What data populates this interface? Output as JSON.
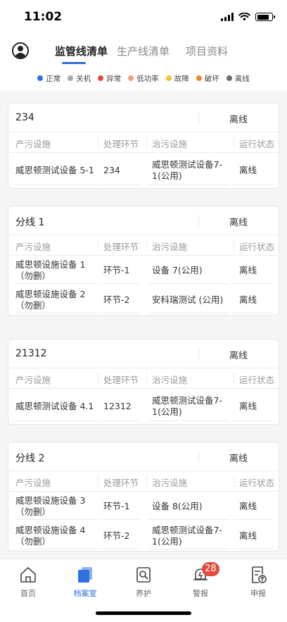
{
  "status_bar": {
    "time": "11:02"
  },
  "header": {
    "tabs": [
      {
        "label": "监管线清单",
        "active": true
      },
      {
        "label": "生产线清单",
        "active": false
      },
      {
        "label": "项目资料",
        "active": false
      }
    ]
  },
  "legend": [
    {
      "label": "正常",
      "color": "#2f6fdf"
    },
    {
      "label": "关机",
      "color": "#a9a9a9"
    },
    {
      "label": "异常",
      "color": "#e0463c"
    },
    {
      "label": "低功率",
      "color": "#f0a07a"
    },
    {
      "label": "故障",
      "color": "#f2c12e"
    },
    {
      "label": "破坏",
      "color": "#e88a2e"
    },
    {
      "label": "离线",
      "color": "#6b6b6b"
    }
  ],
  "columns": {
    "col1": "产污设施",
    "col2": "处理环节",
    "col3": "治污设施",
    "col4": "运行状态"
  },
  "cards": [
    {
      "title": "234",
      "status": "离线",
      "rows": [
        {
          "facility": "威思顿测试设备 5-1",
          "stage": "234",
          "treatment": "威思顿测试设备7-1(公用)",
          "state": "离线"
        }
      ]
    },
    {
      "title": "分线 1",
      "status": "离线",
      "rows": [
        {
          "facility": "威思顿设施设备 1（勿删）",
          "stage": "环节-1",
          "treatment": "设备 7(公用)",
          "state": "离线"
        },
        {
          "facility": "威思顿设施设备 2（勿删）",
          "stage": "环节-2",
          "treatment": "安科瑞测试 (公用)",
          "state": "离线"
        }
      ]
    },
    {
      "title": "21312",
      "status": "离线",
      "rows": [
        {
          "facility": "威思顿测试设备 4.1",
          "stage": "12312",
          "treatment": "威思顿测试设备7-1(公用)",
          "state": "离线"
        }
      ]
    },
    {
      "title": "分线 2",
      "status": "离线",
      "rows": [
        {
          "facility": "威思顿设施设备 3（勿删）",
          "stage": "环节-1",
          "treatment": "设备 8(公用)",
          "state": "离线"
        },
        {
          "facility": "威思顿设施设备 4（勿删）",
          "stage": "环节-2",
          "treatment": "威思顿测试设备7-1(公用)",
          "state": "离线"
        }
      ]
    }
  ],
  "tabbar": {
    "items": [
      {
        "label": "首页",
        "icon": "home-icon",
        "active": false
      },
      {
        "label": "档案室",
        "icon": "archive-icon",
        "active": true
      },
      {
        "label": "养护",
        "icon": "maintenance-icon",
        "active": false
      },
      {
        "label": "警报",
        "icon": "alarm-icon",
        "active": false,
        "badge": "28"
      },
      {
        "label": "申报",
        "icon": "report-icon",
        "active": false
      }
    ]
  }
}
